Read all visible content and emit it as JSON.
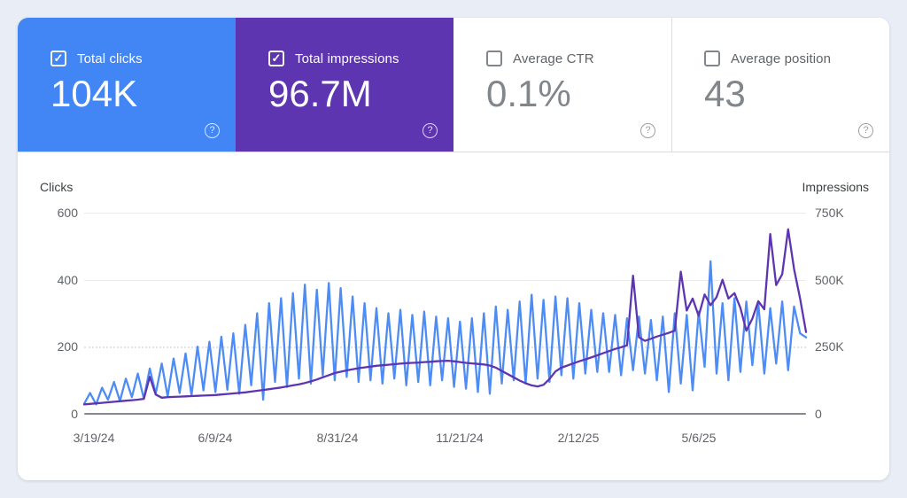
{
  "cards": [
    {
      "label": "Total clicks",
      "value": "104K",
      "checked": true,
      "bg": "#4285f4"
    },
    {
      "label": "Total impressions",
      "value": "96.7M",
      "checked": true,
      "bg": "#5e35b1"
    },
    {
      "label": "Average CTR",
      "value": "0.1%",
      "checked": false,
      "bg": "#ffffff"
    },
    {
      "label": "Average position",
      "value": "43",
      "checked": false,
      "bg": "#ffffff"
    }
  ],
  "icons": {
    "check": "✓",
    "help": "?"
  },
  "colors": {
    "page_background": "#e9edf5",
    "panel_background": "#ffffff",
    "clicks_accent": "#4285f4",
    "impressions_accent": "#5e35b1",
    "muted_text": "#5f6368",
    "value_text": "#80868b",
    "divider": "#dadce0",
    "gridline": "#e8eaed"
  },
  "chart_data": {
    "type": "line",
    "title": "Clicks and impressions over time (daily)",
    "grid": true,
    "legend_position": "none",
    "left_axis": {
      "label": "Clicks",
      "ticks": [
        "600",
        "400",
        "200",
        "0"
      ],
      "min": 0,
      "max": 600
    },
    "right_axis": {
      "label": "Impressions",
      "ticks": [
        "750K",
        "500K",
        "250K",
        "0"
      ],
      "min": 0,
      "max": 750,
      "unit": "K"
    },
    "x_ticks": [
      "3/19/24",
      "6/9/24",
      "8/31/24",
      "11/21/24",
      "2/12/25",
      "5/6/25"
    ],
    "series": [
      {
        "name": "Total clicks",
        "axis": "left",
        "color": "#4e8cf5",
        "values": [
          30,
          62,
          28,
          78,
          42,
          95,
          38,
          105,
          50,
          120,
          45,
          135,
          60,
          150,
          52,
          165,
          62,
          180,
          55,
          200,
          70,
          215,
          65,
          230,
          72,
          240,
          60,
          265,
          85,
          300,
          42,
          330,
          95,
          345,
          80,
          360,
          105,
          385,
          90,
          370,
          115,
          390,
          100,
          375,
          110,
          350,
          95,
          330,
          100,
          315,
          90,
          300,
          105,
          310,
          85,
          295,
          95,
          305,
          85,
          290,
          100,
          285,
          80,
          275,
          75,
          285,
          65,
          300,
          60,
          320,
          90,
          310,
          100,
          335,
          90,
          355,
          105,
          340,
          95,
          350,
          115,
          345,
          105,
          330,
          120,
          310,
          125,
          300,
          125,
          295,
          115,
          285,
          130,
          290,
          120,
          280,
          100,
          290,
          65,
          300,
          90,
          295,
          70,
          305,
          140,
          455,
          120,
          330,
          100,
          345,
          125,
          335,
          145,
          330,
          120,
          315,
          150,
          335,
          130,
          320,
          240,
          228
        ]
      },
      {
        "name": "Total impressions",
        "axis": "right",
        "color": "#5e35b1",
        "values": [
          35,
          37,
          39,
          41,
          43,
          45,
          47,
          49,
          51,
          53,
          56,
          138,
          72,
          60,
          62,
          63,
          64,
          65,
          66,
          67,
          68,
          69,
          70,
          72,
          74,
          76,
          78,
          80,
          83,
          86,
          89,
          92,
          95,
          98,
          102,
          106,
          110,
          115,
          121,
          128,
          136,
          144,
          152,
          157,
          162,
          166,
          170,
          173,
          176,
          179,
          181,
          183,
          185,
          187,
          189,
          190,
          191,
          193,
          194,
          196,
          197,
          198,
          196,
          193,
          190,
          188,
          186,
          184,
          180,
          172,
          160,
          148,
          136,
          124,
          114,
          106,
          102,
          108,
          130,
          158,
          172,
          180,
          188,
          196,
          203,
          210,
          218,
          226,
          234,
          242,
          248,
          255,
          515,
          285,
          272,
          280,
          288,
          295,
          302,
          310,
          530,
          385,
          430,
          365,
          445,
          405,
          435,
          500,
          430,
          450,
          395,
          310,
          355,
          420,
          390,
          670,
          480,
          520,
          688,
          540,
          430,
          305
        ]
      }
    ]
  }
}
